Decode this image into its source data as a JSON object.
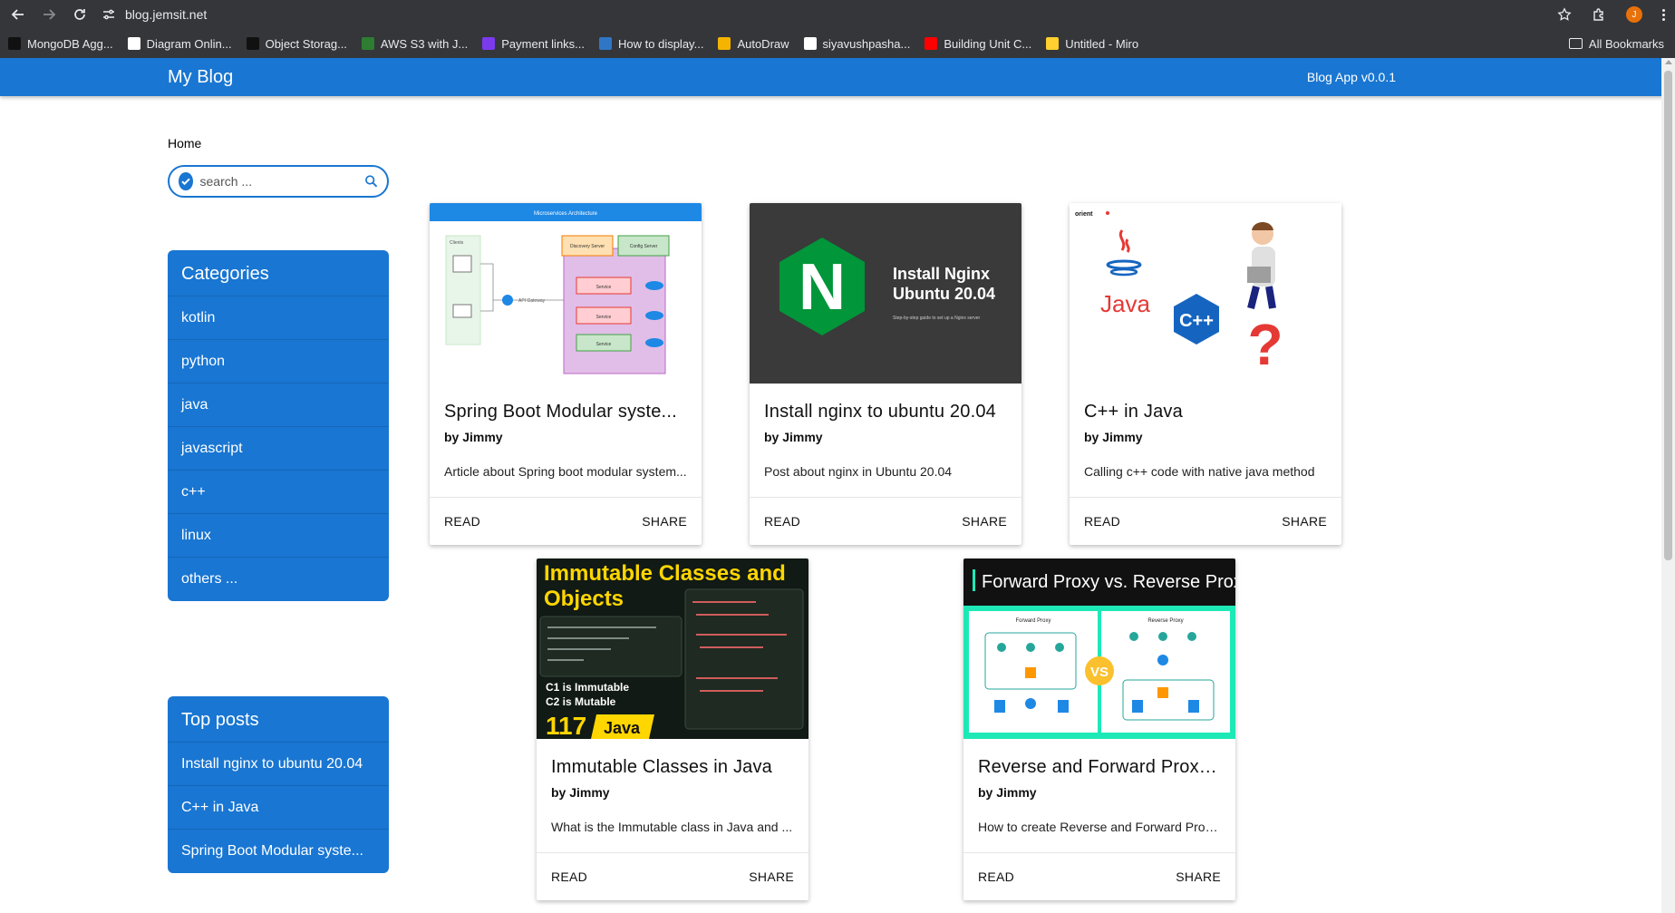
{
  "browser": {
    "url": "blog.jemsit.net",
    "profile_initial": "J",
    "bookmarks": [
      {
        "label": "MongoDB Agg...",
        "icon": "medium-icon",
        "color": "#111111"
      },
      {
        "label": "Diagram Onlin...",
        "icon": "diagram-icon",
        "color": "#ffffff"
      },
      {
        "label": "Object Storag...",
        "icon": "medium-icon",
        "color": "#111111"
      },
      {
        "label": "AWS S3 with J...",
        "icon": "aws-icon",
        "color": "#2e7d32"
      },
      {
        "label": "Payment links...",
        "icon": "stripe-icon",
        "color": "#7c3aed"
      },
      {
        "label": "How to display...",
        "icon": "wordpress-icon",
        "color": "#2f77c6"
      },
      {
        "label": "AutoDraw",
        "icon": "autodraw-icon",
        "color": "#f4b400"
      },
      {
        "label": "siyavushpasha...",
        "icon": "google-icon",
        "color": "#ffffff"
      },
      {
        "label": "Building Unit C...",
        "icon": "youtube-icon",
        "color": "#ff0000"
      },
      {
        "label": "Untitled - Miro",
        "icon": "miro-icon",
        "color": "#ffd02f"
      }
    ],
    "all_bookmarks": "All Bookmarks"
  },
  "header": {
    "brand": "My Blog",
    "version": "Blog App v0.0.1",
    "color": "#1976d2"
  },
  "breadcrumb": "Home",
  "search": {
    "placeholder": "search ..."
  },
  "categories": {
    "title": "Categories",
    "items": [
      "kotlin",
      "python",
      "java",
      "javascript",
      "c++",
      "linux",
      "others ..."
    ]
  },
  "top_posts": {
    "title": "Top posts",
    "items": [
      "Install nginx to ubuntu 20.04",
      "C++ in Java",
      "Spring Boot Modular syste..."
    ]
  },
  "posts": [
    {
      "title": "Spring Boot Modular syste...",
      "author": "by Jimmy",
      "excerpt": "Article about Spring boot modular system...",
      "read": "READ",
      "share": "SHARE",
      "thumb": {
        "header": "Microservices Architecture",
        "clients": "Clients",
        "gateway": "API Gateway",
        "discovery": "Discovery Server",
        "config": "Config Server",
        "service": "Service"
      }
    },
    {
      "title": "Install nginx to ubuntu 20.04",
      "author": "by Jimmy",
      "excerpt": "Post about nginx in Ubuntu 20.04",
      "read": "READ",
      "share": "SHARE",
      "thumb": {
        "letter": "N",
        "line1": "Install Nginx",
        "line2": "Ubuntu 20.04",
        "small": "Step-by-step guide to set up a Nginx server"
      }
    },
    {
      "title": "C++ in Java",
      "author": "by Jimmy",
      "excerpt": "Calling c++ code with native java method",
      "read": "READ",
      "share": "SHARE",
      "thumb": {
        "brand": "orient",
        "java": "Java",
        "cpp": "C++",
        "question": "?"
      }
    },
    {
      "title": "Immutable Classes in Java",
      "author": "by Jimmy",
      "excerpt": "What is the Immutable class in Java and ...",
      "read": "READ",
      "share": "SHARE",
      "thumb": {
        "head1": "Immutable Classes and",
        "head2": "Objects",
        "c1": "C1 is Immutable",
        "c2": "C2 is Mutable",
        "num": "117",
        "lang": "Java"
      }
    },
    {
      "title": "Reverse and Forward Proxy...",
      "author": "by Jimmy",
      "excerpt": "How to create Reverse and Forward Proxi...",
      "read": "READ",
      "share": "SHARE",
      "thumb": {
        "head": "Forward Proxy vs. Reverse Proxy",
        "left": "Forward Proxy",
        "right": "Reverse Proxy",
        "vs": "VS"
      }
    }
  ]
}
